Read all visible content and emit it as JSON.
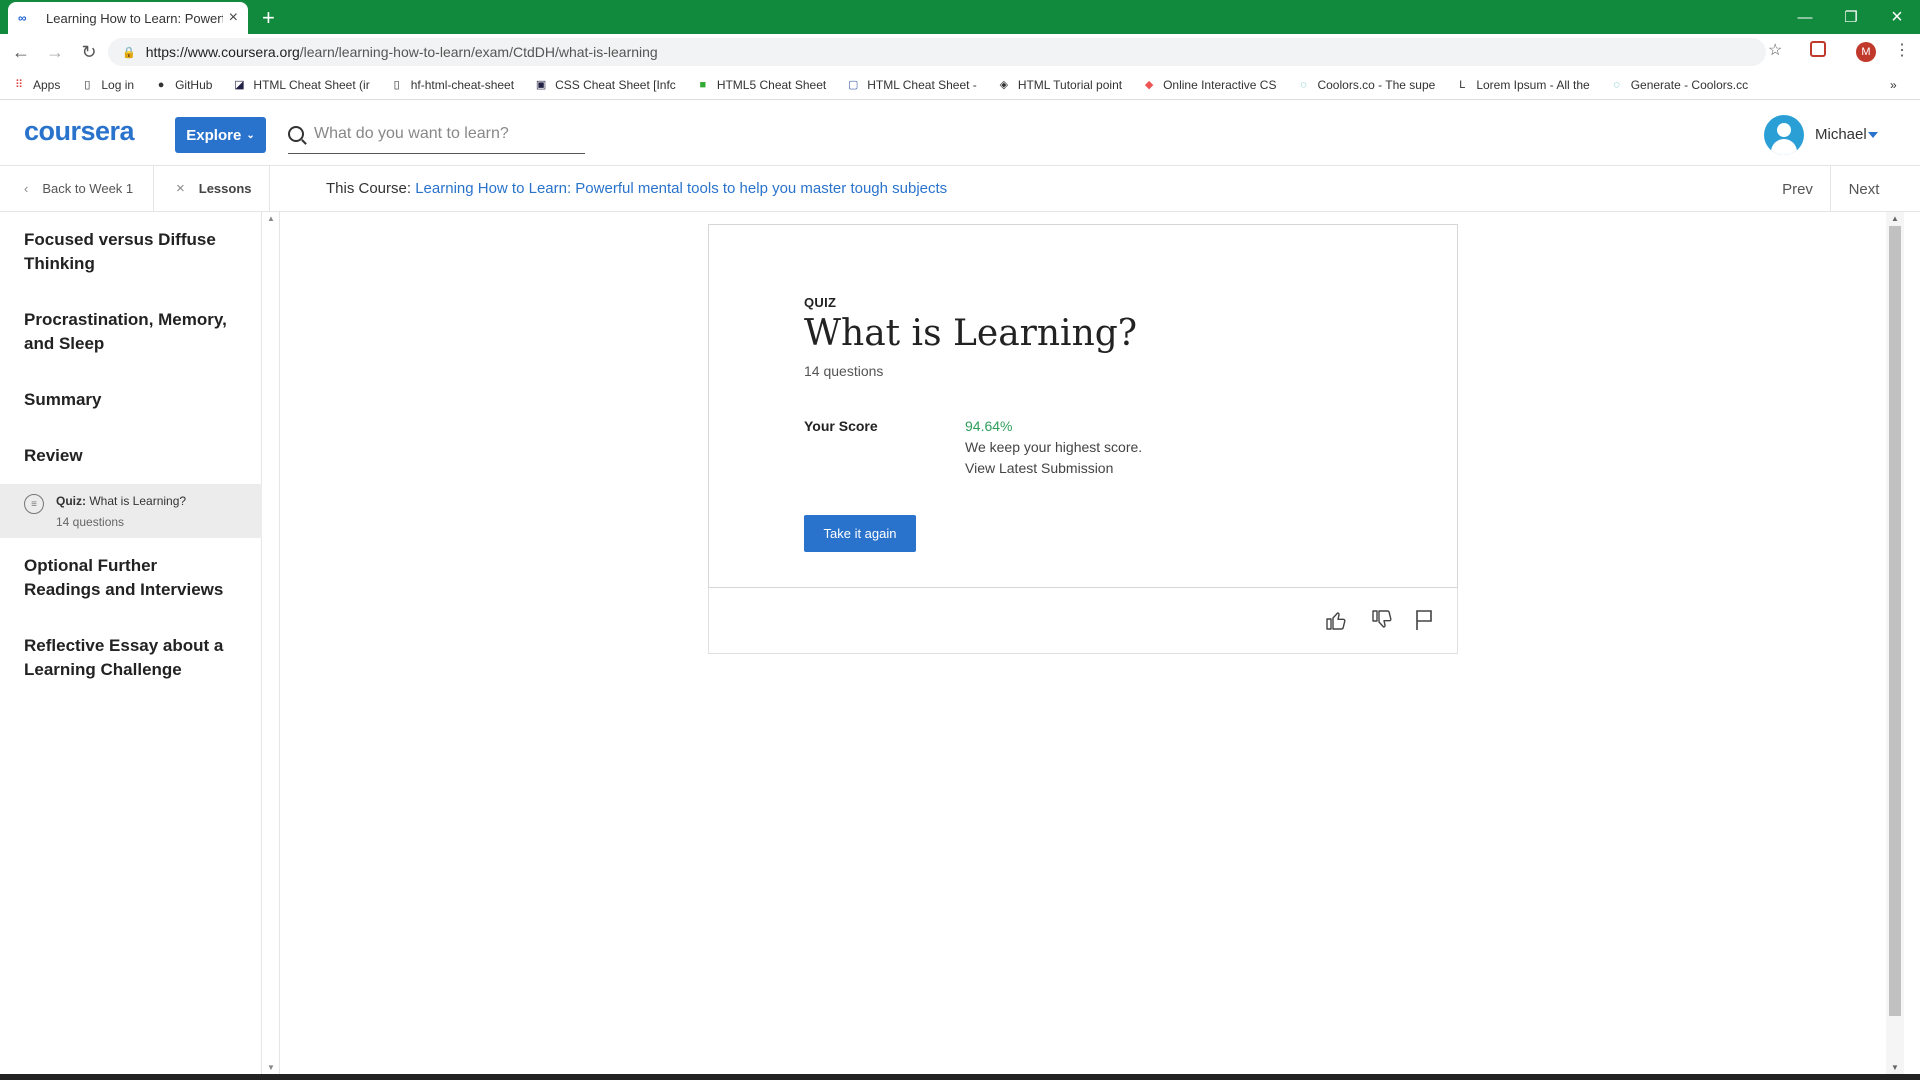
{
  "browser": {
    "tab_title": "Learning How to Learn: Powerful",
    "new_tab": "+",
    "url_host": "https://www.coursera.org",
    "url_path": "/learn/learning-how-to-learn/exam/CtdDH/what-is-learning",
    "profile_initial": "M"
  },
  "bookmarks": [
    {
      "label": "Apps",
      "icon": "apps-grid-icon"
    },
    {
      "label": "Log in",
      "icon": "page-icon"
    },
    {
      "label": "GitHub",
      "icon": "github-icon"
    },
    {
      "label": "HTML Cheat Sheet (ir",
      "icon": "bookmark-icon"
    },
    {
      "label": "hf-html-cheat-sheet",
      "icon": "page-icon"
    },
    {
      "label": "CSS Cheat Sheet [Infc",
      "icon": "bookmark-icon"
    },
    {
      "label": "HTML5 Cheat Sheet",
      "icon": "bookmark-icon"
    },
    {
      "label": "HTML Cheat Sheet -",
      "icon": "bookmark-icon"
    },
    {
      "label": "HTML Tutorial point",
      "icon": "bookmark-icon"
    },
    {
      "label": "Online Interactive CS",
      "icon": "bookmark-icon"
    },
    {
      "label": "Coolors.co - The supe",
      "icon": "bookmark-icon"
    },
    {
      "label": "Lorem Ipsum - All the",
      "icon": "bookmark-icon"
    },
    {
      "label": "Generate - Coolors.cc",
      "icon": "bookmark-icon"
    }
  ],
  "header": {
    "logo": "coursera",
    "explore_label": "Explore",
    "search_placeholder": "What do you want to learn?",
    "username": "Michael"
  },
  "subnav": {
    "back_label": "Back to Week 1",
    "lessons_label": "Lessons",
    "course_prefix": "This Course: ",
    "course_name": "Learning How to Learn: Powerful mental tools to help you master tough subjects",
    "prev_label": "Prev",
    "next_label": "Next"
  },
  "sidebar": {
    "sections": [
      "Focused versus Diffuse Thinking",
      "Procrastination, Memory, and Sleep",
      "Summary",
      "Review"
    ],
    "active_item": {
      "type_label": "Quiz:",
      "title": "What is Learning?",
      "sub": "14 questions"
    },
    "sections_after": [
      "Optional Further Readings and Interviews",
      "Reflective Essay about a Learning Challenge"
    ]
  },
  "quiz": {
    "label": "QUIZ",
    "title": "What is Learning?",
    "count": "14 questions",
    "score_label": "Your Score",
    "score_value": "94.64%",
    "score_note": "We keep your highest score.",
    "view_submission": "View Latest Submission",
    "retake_label": "Take it again"
  },
  "colors": {
    "chrome_green": "#128a3d",
    "brand_blue": "#2a73cc",
    "score_green": "#2e9e5b"
  }
}
